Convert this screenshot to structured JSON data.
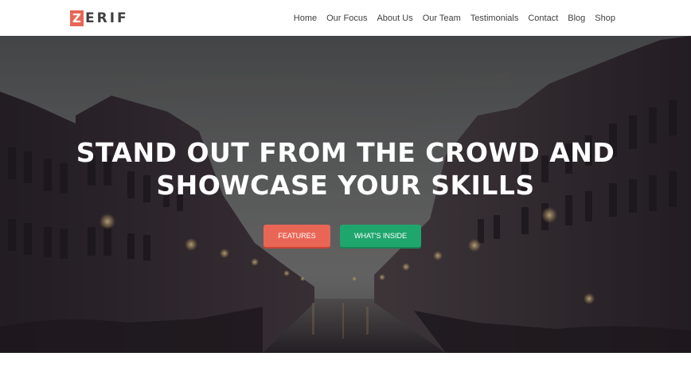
{
  "brand": {
    "mark": "Z",
    "rest": "ERIF",
    "accent_color": "#e96656"
  },
  "nav": {
    "items": [
      "Home",
      "Our Focus",
      "About Us",
      "Our Team",
      "Testimonials",
      "Contact",
      "Blog",
      "Shop"
    ]
  },
  "hero": {
    "title_line1": "STAND OUT FROM THE CROWD AND",
    "title_line2": "SHOWCASE YOUR SKILLS",
    "features_button": "FEATURES",
    "inside_button": "WHAT'S INSIDE",
    "features_color": "#e96656",
    "inside_color": "#1fa66d"
  }
}
